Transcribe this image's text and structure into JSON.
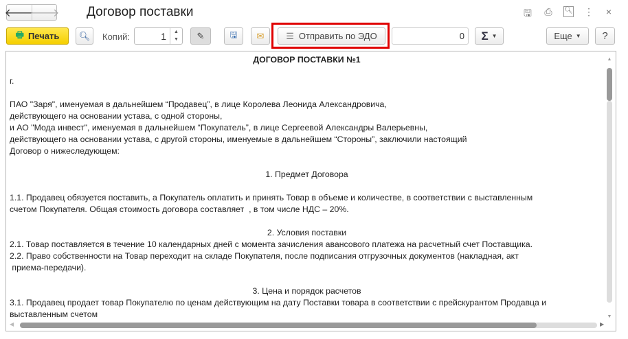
{
  "window": {
    "title": "Договор поставки"
  },
  "nav": {
    "back_icon": "arrow-left",
    "forward_icon": "arrow-right"
  },
  "title_icons": [
    "save-icon",
    "print-icon",
    "preview-icon",
    "more-vertical-icon",
    "close-icon"
  ],
  "toolbar": {
    "print_label": "Печать",
    "copies_label": "Копий:",
    "copies_value": "1",
    "send_edo_label": "Отправить по ЭДО",
    "sum_value": "0",
    "sigma_label": "Σ",
    "more_label": "Еще",
    "help_label": "?",
    "highlight_color": "#e00000"
  },
  "document": {
    "heading": "ДОГОВОР ПОСТАВКИ №1",
    "lines": [
      {
        "t": "г.",
        "c": false
      },
      {
        "t": "",
        "c": false
      },
      {
        "t": "ПАО \"Заря\", именуемая в дальнейшем “Продавец”, в лице Королева Леонида Александровича,",
        "c": false
      },
      {
        "t": "действующего на основании устава, с одной стороны,",
        "c": false
      },
      {
        "t": "и АО \"Мода инвест\", именуемая в дальнейшем “Покупатель”, в лице Сергеевой Александры Валерьевны,",
        "c": false
      },
      {
        "t": "действующего на основании устава, с другой стороны, именуемые в дальнейшем “Стороны”, заключили настоящий",
        "c": false
      },
      {
        "t": "Договор о нижеследующем:",
        "c": false
      },
      {
        "t": "",
        "c": false
      },
      {
        "t": "1. Предмет Договора",
        "c": true
      },
      {
        "t": "",
        "c": false
      },
      {
        "t": "1.1. Продавец обязуется поставить, а Покупатель оплатить и принять Товар в объеме и количестве, в соответствии с выставленным",
        "c": false
      },
      {
        "t": "счетом Покупателя. Общая стоимость договора составляет  , в том числе НДС – 20%.",
        "c": false
      },
      {
        "t": "",
        "c": false
      },
      {
        "t": "2. Условия поставки",
        "c": true
      },
      {
        "t": "2.1. Товар поставляется в течение 10 календарных дней с момента зачисления авансового платежа на расчетный счет Поставщика.",
        "c": false
      },
      {
        "t": "2.2. Право собственности на Товар переходит на складе Покупателя, после подписания отгрузочных документов (накладная, акт",
        "c": false
      },
      {
        "t": " приема-передачи).",
        "c": false
      },
      {
        "t": "",
        "c": false
      },
      {
        "t": "3. Цена и порядок расчетов",
        "c": true
      },
      {
        "t": "3.1. Продавец продает товар Покупателю по ценам действующим на дату Поставки товара в соответствии с прейскурантом Продавца и",
        "c": false
      },
      {
        "t": "выставленным счетом",
        "c": false
      }
    ]
  }
}
